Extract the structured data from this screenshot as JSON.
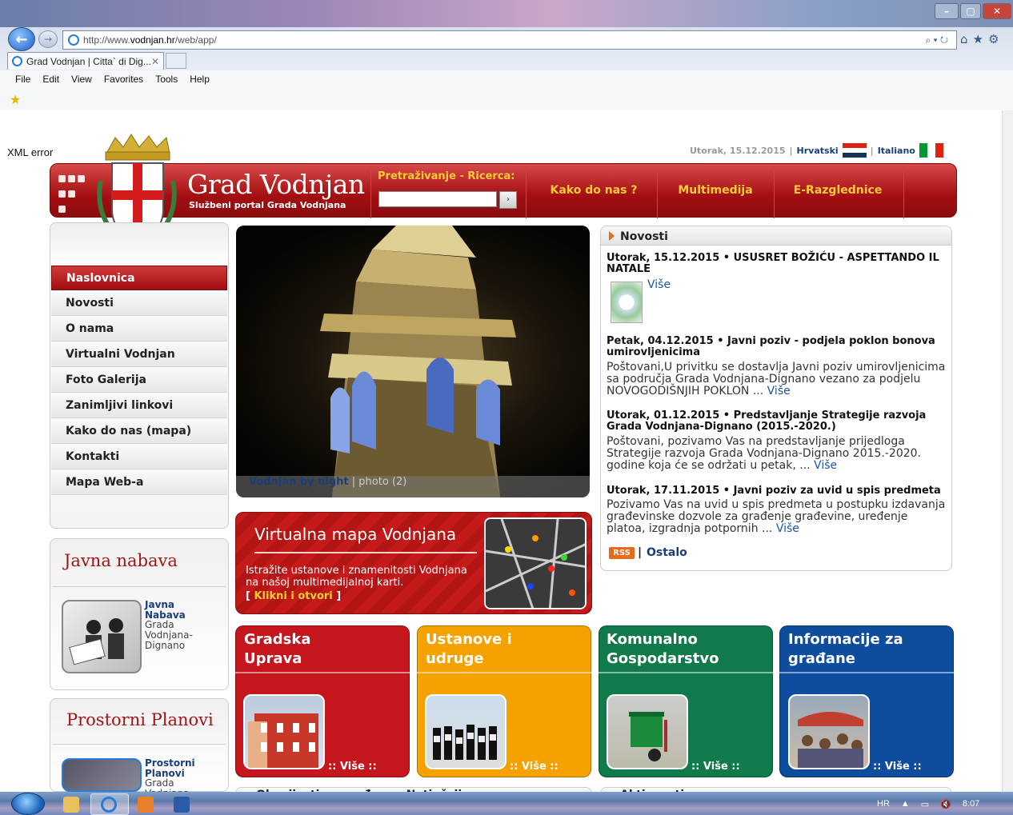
{
  "browser": {
    "url_base": "http://www.",
    "url_domain": "vodnjan.hr",
    "url_path": "/web/app/",
    "tab_title": "Grad Vodnjan | Citta` di Dig...",
    "menu": [
      "File",
      "Edit",
      "View",
      "Favorites",
      "Tools",
      "Help"
    ]
  },
  "page": {
    "xml_error": "XML error",
    "date": "Utorak, 15.12.2015",
    "lang_hr": "Hrvatski",
    "lang_it": "Italiano",
    "site_title": "Grad Vodnjan",
    "site_subtitle": "Službeni portal Grada Vodnjana",
    "search_label": "Pretraživanje - Ricerca:",
    "search_btn": "›",
    "top_nav": [
      "Kako do nas ?",
      "Multimedija",
      "E-Razglednice"
    ],
    "sidebar": [
      "Naslovnica",
      "Novosti",
      "O nama",
      "Virtualni Vodnjan",
      "Foto Galerija",
      "Zanimljivi linkovi",
      "Kako do nas (mapa)",
      "Kontakti",
      "Mapa Web-a"
    ],
    "box1": {
      "title": "Javna nabava",
      "link": "Javna Nabava",
      "sub": "Grada Vodnjana-Dignano"
    },
    "box2": {
      "title": "Prostorni Planovi",
      "link": "Prostorni Planovi",
      "sub": "Grada Vodnjana-"
    },
    "hero": {
      "caption_bold": "Vodnjan by night",
      "caption_rest": " | photo (2)"
    },
    "vmap": {
      "title": "Virtualna mapa Vodnjana",
      "desc": "Istražite ustanove i znamenitosti Vodnjana na našoj multimedijalnoj karti.",
      "link_open": "[ ",
      "link": "Klikni i otvori",
      "link_close": " ]"
    },
    "news": {
      "header": "Novosti",
      "items": [
        {
          "title": "Utorak, 15.12.2015 • USUSRET BOŽIĆU - ASPETTANDO IL NATALE",
          "text": "",
          "more": "Više"
        },
        {
          "title": "Petak, 04.12.2015 • Javni poziv - podjela poklon bonova umirovljenicima",
          "text": "Poštovani,U privitku se dostavlja Javni poziv umirovljenicima sa područja Grada Vodnjana-Dignano vezano za podjelu NOVOGODIŠNJIH POKLON ... ",
          "more": "Više"
        },
        {
          "title": "Utorak, 01.12.2015 • Predstavljanje Strategije razvoja Grada Vodnjana-Dignano (2015.-2020.)",
          "text": "Poštovani, pozivamo Vas na predstavljanje prijedloga Strategije razvoja Grada Vodnjana-Dignano 2015.-2020. godine koja će se održati u petak, ... ",
          "more": "Više"
        },
        {
          "title": "Utorak, 17.11.2015 • Javni poziv za uvid u spis predmeta",
          "text": "Pozivamo Vas na uvid u spis predmeta u postupku izdavanja građevinske dozvole za građenje građevine, uređenje platoa, izgradnja potpornih ... ",
          "more": "Više"
        }
      ],
      "rss": "RSS",
      "sep": "|",
      "other": "Ostalo"
    },
    "tiles": [
      {
        "title1": "Gradska",
        "title2": "Uprava",
        "more": ":: Više ::",
        "color": "#c4161c"
      },
      {
        "title1": "Ustanove i",
        "title2": "udruge",
        "more": ":: Više ::",
        "color": "#f5a100"
      },
      {
        "title1": "Komunalno",
        "title2": "Gospodarstvo",
        "more": ":: Više ::",
        "color": "#117a4a"
      },
      {
        "title1": "Informacije za",
        "title2": "građane",
        "more": ":: Više ::",
        "color": "#0e4c9e"
      }
    ],
    "bottom_heads": [
      "Obavijesti za građane - Natječaji",
      "Aktivnosti"
    ]
  },
  "taskbar": {
    "lang": "HR",
    "time": "8:07"
  }
}
